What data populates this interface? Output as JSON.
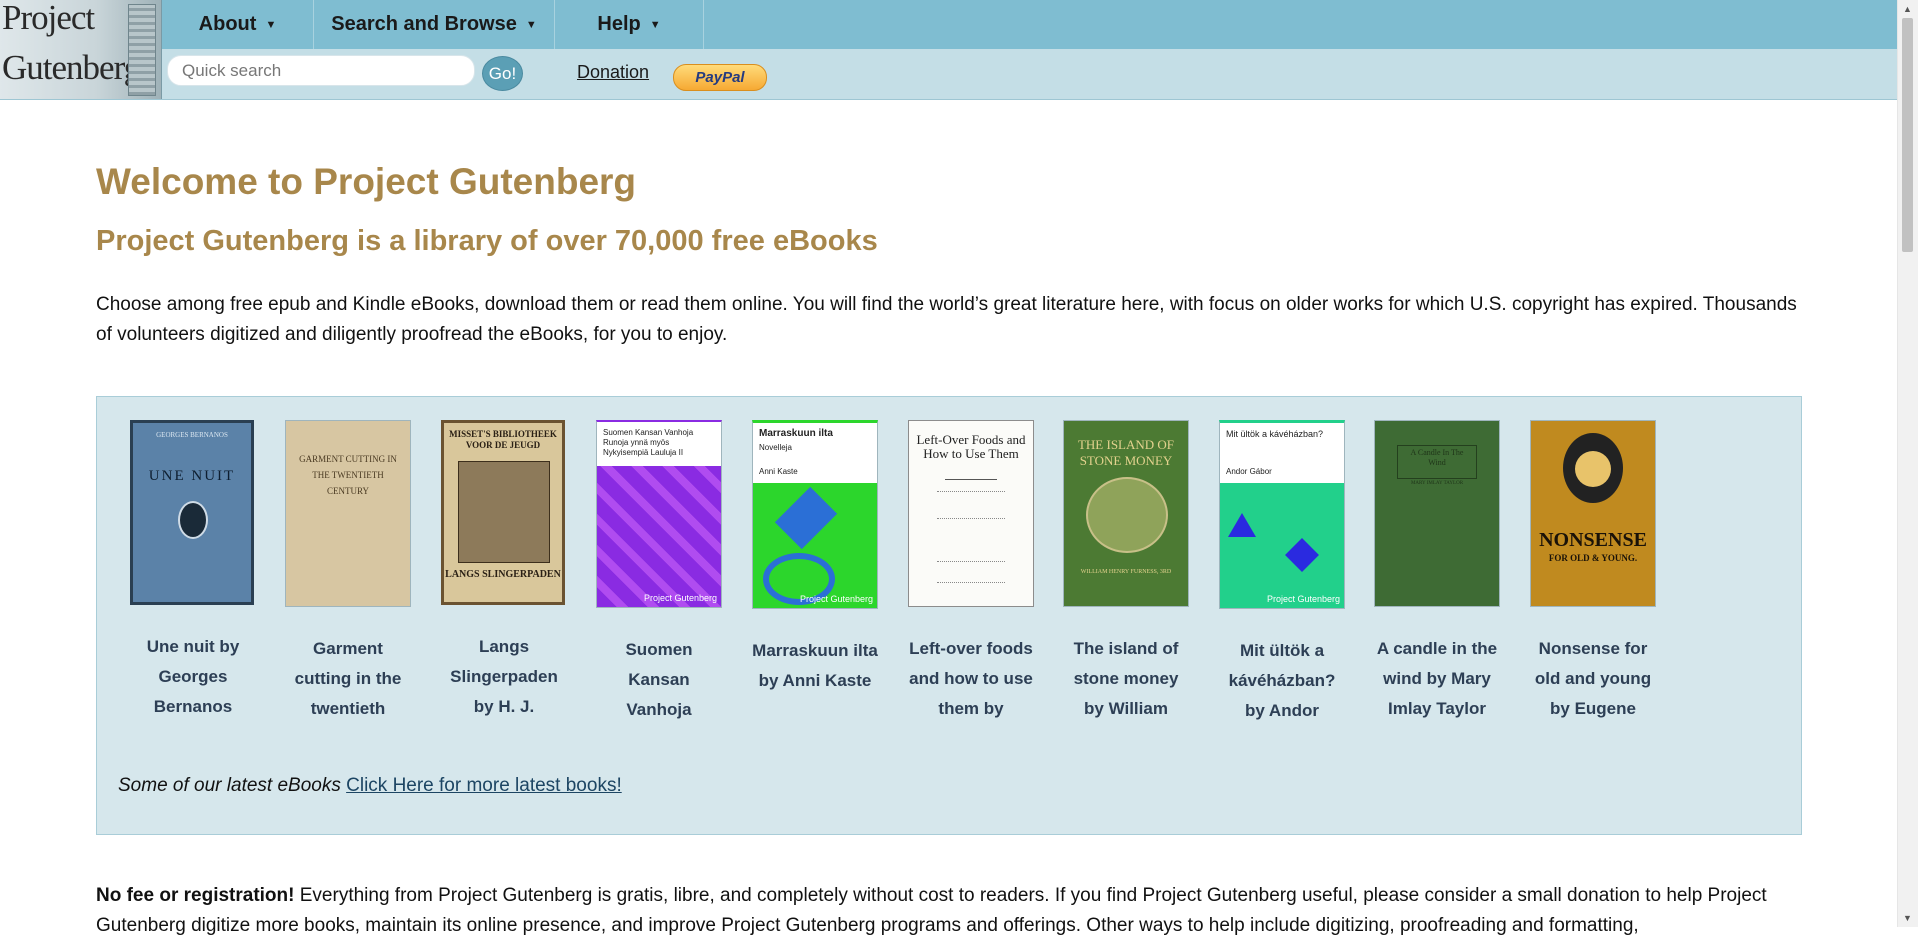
{
  "logo": {
    "line1": "Project",
    "line2": "Gutenberg"
  },
  "nav": [
    {
      "label": "About"
    },
    {
      "label": "Search and Browse"
    },
    {
      "label": "Help"
    }
  ],
  "search": {
    "placeholder": "Quick search",
    "go_label": "Go!"
  },
  "donation": {
    "label": "Donation",
    "paypal_label": "PayPal"
  },
  "main": {
    "title": "Welcome to Project Gutenberg",
    "subtitle": "Project Gutenberg is a library of over 70,000 free eBooks",
    "intro": "Choose among free epub and Kindle eBooks, download them or read them online. You will find the world’s great literature here, with focus on older works for which U.S. copyright has expired. Thousands of volunteers digitized and diligently proofread the eBooks, for you to enjoy.",
    "latest_prefix": "Some of our latest eBooks",
    "latest_link": "Click Here for more latest books!",
    "nofee_bold": "No fee or registration!",
    "nofee_text": " Everything from Project Gutenberg is gratis, libre, and completely without cost to readers. If you find Project Gutenberg useful, please consider a small donation to help Project Gutenberg digitize more books, maintain its online presence, and improve Project Gutenberg programs and offerings. Other ways to help include digitizing, proofreading and formatting,"
  },
  "books": [
    {
      "title": "Une nuit by Georges Bernanos",
      "cover_author": "GEORGES BERNANOS",
      "cover_title": "UNE NUIT"
    },
    {
      "title": "Garment cutting in the twentieth",
      "cover_title": "GARMENT CUTTING IN THE TWENTIETH CENTURY"
    },
    {
      "title": "Langs Slingerpaden by H. J.",
      "cover_title": "MISSET'S BIBLIOTHEEK VOOR DE JEUGD",
      "cover_sub": "LANGS SLINGERPADEN"
    },
    {
      "title": "Suomen Kansan Vanhoja",
      "cover_title": "Suomen Kansan Vanhoja Runoja ynnä myös Nykyisempiä Lauluja II",
      "cover_brand": "Project Gutenberg"
    },
    {
      "title": "Marraskuun ilta by Anni Kaste",
      "cover_title": "Marraskuun ilta",
      "cover_sub": "Novelleja",
      "cover_author": "Anni Kaste",
      "cover_brand": "Project Gutenberg"
    },
    {
      "title": "Left-over foods and how to use them by",
      "cover_title": "Left-Over Foods and How to Use Them"
    },
    {
      "title": "The island of stone money by William",
      "cover_title": "THE ISLAND OF STONE MONEY",
      "cover_author": "WILLIAM HENRY FURNESS, 3RD"
    },
    {
      "title": "Mit ültök a kávéházban? by Andor",
      "cover_title": "Mit ültök a kávéházban?",
      "cover_author": "Andor Gábor",
      "cover_brand": "Project Gutenberg"
    },
    {
      "title": "A candle in the wind by Mary Imlay Taylor",
      "cover_title": "A Candle In The Wind",
      "cover_author": "MARY IMLAY TAYLOR"
    },
    {
      "title": "Nonsense for old and young by Eugene",
      "cover_title": "NONSENSE",
      "cover_sub": "FOR OLD & YOUNG."
    }
  ],
  "colors": {
    "header": "#7fbdd1",
    "subheader": "#c4dee6",
    "heading": "#a8874b",
    "panel": "#d6e7ec"
  }
}
